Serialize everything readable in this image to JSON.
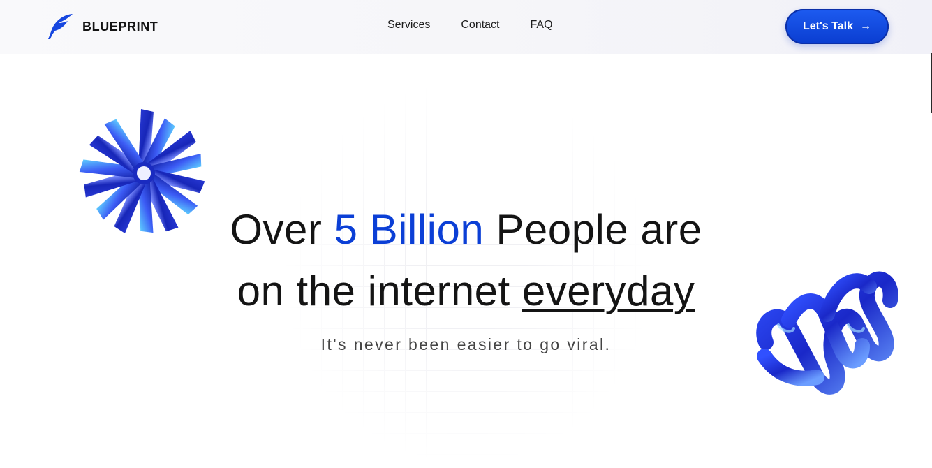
{
  "brand": {
    "name": "BLUEPRINT",
    "logo_icon": "feather-icon"
  },
  "nav": {
    "links": [
      "Services",
      "Contact",
      "FAQ"
    ]
  },
  "cta": {
    "label": "Let's Talk",
    "icon": "arrow-right-icon"
  },
  "hero": {
    "line1_part1": "Over",
    "line1_accent": "5 Billion",
    "line1_part2": "People are",
    "line2_part1": "on the internet",
    "line2_emphasis": "everyday",
    "subtitle": "It's never been easier to go viral."
  },
  "colors": {
    "accent": "#0b3fd6",
    "text": "#141414",
    "cta_bg": "#1d5bf0"
  },
  "decorations": [
    "blue-3d-starburst-shape",
    "blue-3d-spring-coil-shape"
  ]
}
